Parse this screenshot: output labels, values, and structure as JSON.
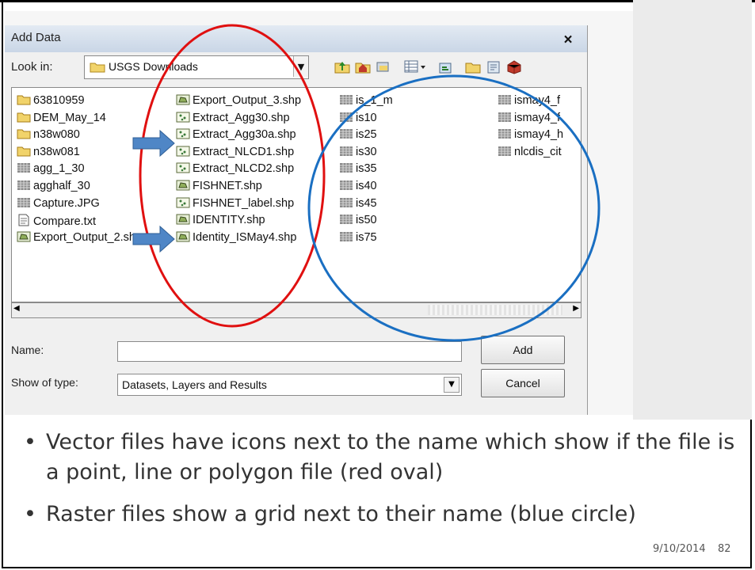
{
  "dialog": {
    "title": "Add Data",
    "close_label": "×",
    "look_in_label": "Look in:",
    "look_in_value": "USGS Downloads",
    "name_label": "Name:",
    "name_value": "",
    "type_label": "Show of type:",
    "type_value": "Datasets, Layers and Results",
    "add_label": "Add",
    "cancel_label": "Cancel",
    "toolbar_icons": [
      "up-one-level-icon",
      "home-icon",
      "connect-folder-icon",
      "view-options-icon",
      "new-item-icon",
      "folder-icon",
      "catalog-icon",
      "toolbox-icon"
    ]
  },
  "files": {
    "col1": [
      {
        "name": "63810959",
        "icon": "folder-icon"
      },
      {
        "name": "DEM_May_14",
        "icon": "folder-icon"
      },
      {
        "name": "n38w080",
        "icon": "folder-icon"
      },
      {
        "name": "n38w081",
        "icon": "folder-icon"
      },
      {
        "name": "agg_1_30",
        "icon": "raster-icon"
      },
      {
        "name": "agghalf_30",
        "icon": "raster-icon"
      },
      {
        "name": "Capture.JPG",
        "icon": "raster-icon"
      },
      {
        "name": "Compare.txt",
        "icon": "text-file-icon"
      },
      {
        "name": "Export_Output_2.shp",
        "icon": "polygon-icon"
      }
    ],
    "col2": [
      {
        "name": "Export_Output_3.shp",
        "icon": "polygon-icon"
      },
      {
        "name": "Extract_Agg30.shp",
        "icon": "point-icon"
      },
      {
        "name": "Extract_Agg30a.shp",
        "icon": "point-icon"
      },
      {
        "name": "Extract_NLCD1.shp",
        "icon": "point-icon"
      },
      {
        "name": "Extract_NLCD2.shp",
        "icon": "point-icon"
      },
      {
        "name": "FISHNET.shp",
        "icon": "polygon-icon"
      },
      {
        "name": "FISHNET_label.shp",
        "icon": "point-icon"
      },
      {
        "name": "IDENTITY.shp",
        "icon": "polygon-icon"
      },
      {
        "name": "Identity_ISMay4.shp",
        "icon": "polygon-icon"
      }
    ],
    "col3": [
      {
        "name": "is_1_m",
        "icon": "raster-icon"
      },
      {
        "name": "is10",
        "icon": "raster-icon"
      },
      {
        "name": "is25",
        "icon": "raster-icon"
      },
      {
        "name": "is30",
        "icon": "raster-icon"
      },
      {
        "name": "is35",
        "icon": "raster-icon"
      },
      {
        "name": "is40",
        "icon": "raster-icon"
      },
      {
        "name": "is45",
        "icon": "raster-icon"
      },
      {
        "name": "is50",
        "icon": "raster-icon"
      },
      {
        "name": "is75",
        "icon": "raster-icon"
      }
    ],
    "col4": [
      {
        "name": "ismay4_f",
        "icon": "raster-icon"
      },
      {
        "name": "ismay4_f",
        "icon": "raster-icon"
      },
      {
        "name": "ismay4_h",
        "icon": "raster-icon"
      },
      {
        "name": "nlcdis_cit",
        "icon": "raster-icon"
      }
    ]
  },
  "annotations": {
    "red_oval_color": "#e01010",
    "blue_circle_color": "#1a6fc2",
    "arrow_color": "#4f86c6"
  },
  "slide": {
    "bullets": [
      "Vector files have icons next to the name which show if the file is a point, line or polygon file (red oval)",
      "Raster files show a grid next to their name (blue circle)"
    ],
    "date": "9/10/2014",
    "page": "82"
  }
}
